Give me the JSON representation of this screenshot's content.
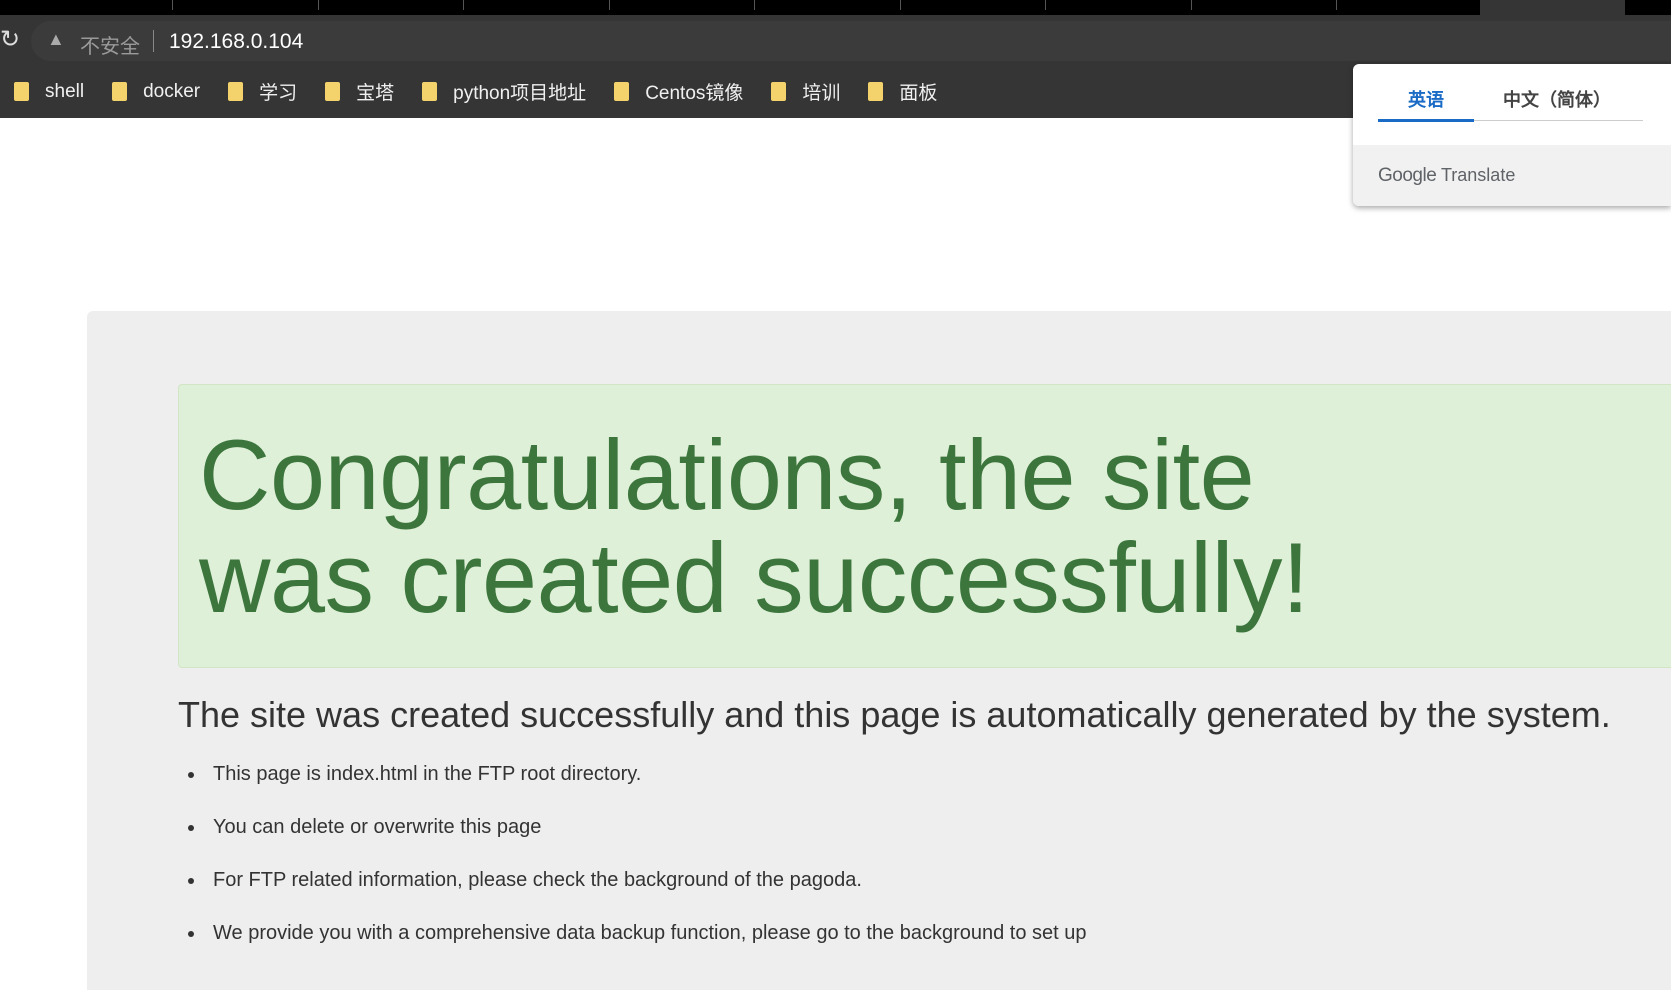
{
  "browser": {
    "security_label": "不安全",
    "url": "192.168.0.104",
    "bookmarks": [
      "shell",
      "docker",
      "学习",
      "宝塔",
      "python项目地址",
      "Centos镜像",
      "培训",
      "面板"
    ]
  },
  "translate_popup": {
    "tabs": [
      "英语",
      "中文（简体）"
    ],
    "active_tab": "英语",
    "brand_google": "Google",
    "brand_translate": "Translate"
  },
  "page": {
    "heading": "Congratulations, the site was created successfully!",
    "subtitle": "The site was created successfully and this page is automatically generated by the system.",
    "items": [
      "This page is index.html in the FTP root directory.",
      "You can delete or overwrite this page",
      "For FTP related information, please check the background of the pagoda.",
      "We provide you with a comprehensive data backup function, please go to the background to set up"
    ]
  },
  "colors": {
    "heading": "#3c763d",
    "hero_bg": "#dff0d8",
    "accent": "#1a6bc6"
  }
}
